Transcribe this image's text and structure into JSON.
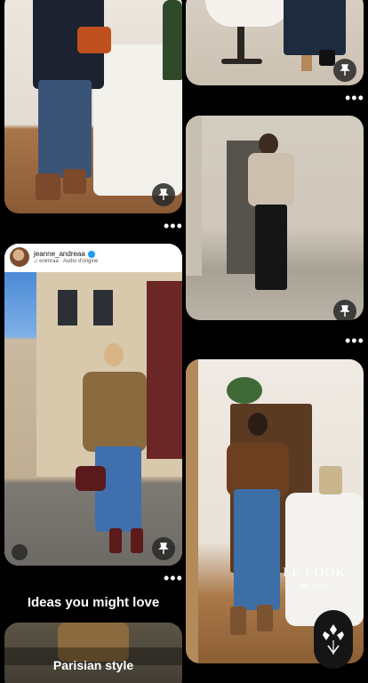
{
  "feed": {
    "pins": [
      {
        "id": "pin1",
        "more": "•••"
      },
      {
        "id": "pin2",
        "more": "•••"
      },
      {
        "id": "pin3",
        "more": "•••"
      },
      {
        "id": "pin4",
        "more": "•••",
        "creator": {
          "name": "jeanne_andreaa",
          "audio": "♫ enimraa · Audio d'origine"
        }
      },
      {
        "id": "pin5",
        "more": "•••",
        "overlay_title": "LE LOOK",
        "overlay_subtitle": "du jour"
      },
      {
        "id": "pin6",
        "title": "Parisian style"
      }
    ],
    "section_title": "Ideas you might love"
  },
  "icons": {
    "back": "chevron-left-icon",
    "pin": "pushpin-icon",
    "fab": "app-logo-icon"
  }
}
